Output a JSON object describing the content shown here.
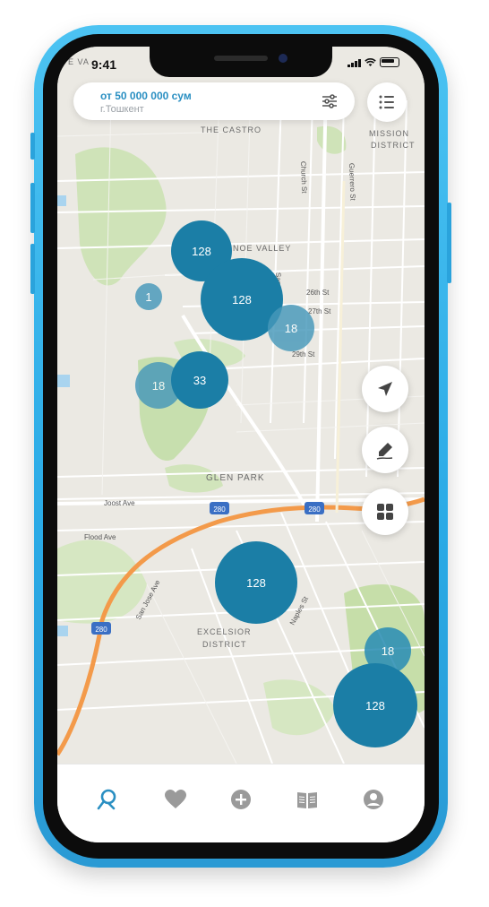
{
  "status_bar": {
    "time": "9:41"
  },
  "search": {
    "price": "от 50 000 000 сум",
    "city": "г.Тошкент"
  },
  "map_labels": {
    "castro": "THE CASTRO",
    "mission": "MISSION",
    "district": "DISTRICT",
    "noe_valley": "NOE VALLEY",
    "glen_park": "GLEN PARK",
    "excelsior": "EXCELSIOR",
    "excelsior_district": "DISTRICT",
    "church_st": "Church St",
    "guerrero_st": "Guerrero St",
    "sanchez_st": "Sanchez St",
    "st_26": "26th St",
    "st_27": "27th St",
    "st_29": "29th St",
    "joost_ave": "Joost Ave",
    "flood_ave": "Flood Ave",
    "san_jose_ave": "San Jose Ave",
    "naples_st": "Naples St",
    "hw_280a": "280",
    "hw_280b": "280",
    "hw_280c": "280",
    "sa": "E VA"
  },
  "clusters": [
    {
      "label": "128"
    },
    {
      "label": "1"
    },
    {
      "label": "128"
    },
    {
      "label": "18"
    },
    {
      "label": "18"
    },
    {
      "label": "33"
    },
    {
      "label": "128"
    },
    {
      "label": "18"
    },
    {
      "label": "128"
    }
  ],
  "tabs": [
    "search",
    "favorites",
    "add",
    "catalog",
    "profile"
  ],
  "colors": {
    "accent": "#2a8fc2",
    "cluster": "#1b7ea6",
    "frame": "#2aaae6",
    "icon_gray": "#9a9a9a",
    "highway": "#f39a4a"
  }
}
